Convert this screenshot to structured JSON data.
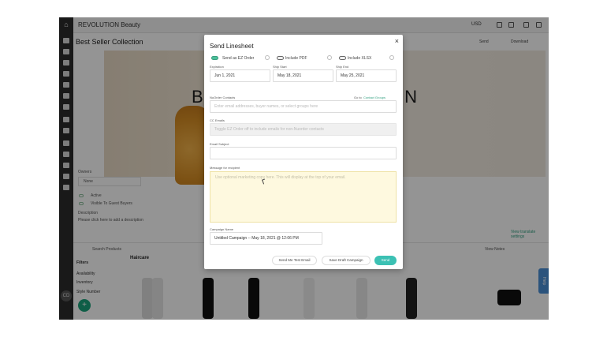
{
  "app": {
    "brand": "REVOLUTION Beauty",
    "currency": "USD"
  },
  "page": {
    "title": "Best Seller Collection",
    "send_label": "Send",
    "download_label": "Download",
    "banner_text_left": "B",
    "banner_text_right": "ON",
    "owners_label": "Owners",
    "owners_value": "None",
    "active_label": "Active",
    "visible_label": "Visible To Guest Buyers",
    "description_label": "Description",
    "description_placeholder": "Please click here to add a description",
    "search_placeholder": "Search Products",
    "view_notes_label": "View Notes",
    "filters": [
      "Filters",
      "Availability",
      "Inventory",
      "Style Number"
    ],
    "haircare_label": "Haircare",
    "translate_link": "View translate settings",
    "avatar_initials": "CD",
    "help_label": "Help",
    "fab_label": "+"
  },
  "modal": {
    "title": "Send Linesheet",
    "close": "×",
    "toggles": [
      {
        "label": "Send as EZ Order",
        "on": true
      },
      {
        "label": "Include PDF",
        "on": false
      },
      {
        "label": "Include XLSX",
        "on": false
      }
    ],
    "expiration": {
      "label": "Expiration",
      "value": "Jun 1, 2021"
    },
    "ship_start": {
      "label": "Ship Start",
      "value": "May 18, 2021"
    },
    "ship_end": {
      "label": "Ship End",
      "value": "May 25, 2021"
    },
    "contacts": {
      "label": "NuOrder Contacts",
      "link_prefix": "Go to",
      "link": "Contact Groups",
      "placeholder": "Enter email addresses, buyer names, or select groups here"
    },
    "cc": {
      "label": "CC Emails",
      "placeholder": "Toggle EZ Order off to include emails for non-Nuorder contacts"
    },
    "subject": {
      "label": "Email Subject",
      "value": ""
    },
    "message": {
      "label": "Message for recipient",
      "placeholder": "Use optional marketing copy here. This will display at the top of your email."
    },
    "campaign": {
      "label": "Campaign Name",
      "value": "Untitled Campaign -- May 18, 2021 @ 12:06 PM"
    },
    "buttons": {
      "test": "Send Me Test Email",
      "draft": "Save Draft Campaign",
      "send": "Send"
    }
  }
}
